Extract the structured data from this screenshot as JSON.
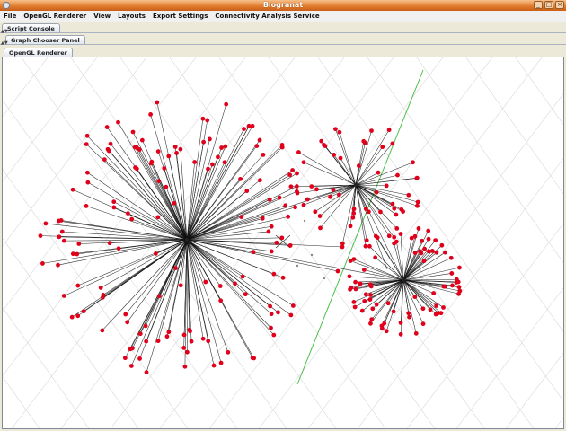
{
  "window": {
    "title": "Biogranat"
  },
  "menu": [
    {
      "id": "file",
      "label": "File"
    },
    {
      "id": "opengl-renderer",
      "label": "OpenGL Renderer"
    },
    {
      "id": "view",
      "label": "View"
    },
    {
      "id": "layouts",
      "label": "Layouts"
    },
    {
      "id": "export-settings",
      "label": "Export Settings"
    },
    {
      "id": "connectivity-analysis-service",
      "label": "Connectivity Analysis Service"
    }
  ],
  "panels": {
    "script_console": "Script Console",
    "graph_chooser": "Graph Chooser Panel",
    "renderer_tab": "OpenGL Renderer"
  },
  "colors": {
    "node": "#e0001b",
    "edge": "#111111",
    "grid": "#d8d8d8",
    "axis": "#4cc04c"
  }
}
